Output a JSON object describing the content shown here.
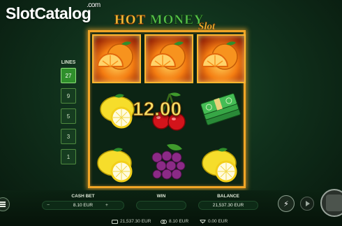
{
  "watermark": {
    "brand": "SlotCatalog",
    "suffix": ".com"
  },
  "logo": {
    "word_hot": "HOT",
    "word_money": "MONEY",
    "word_slot": "Slot"
  },
  "lines": {
    "title": "LINES",
    "options": [
      "27",
      "9",
      "5",
      "3",
      "1"
    ],
    "selected": "27"
  },
  "reels": [
    [
      "orange-fire",
      "lemon",
      "lemon"
    ],
    [
      "orange-fire",
      "cherries",
      "grapes"
    ],
    [
      "orange-fire",
      "cash-stack",
      "lemon"
    ]
  ],
  "win_display": "12.00",
  "bottom": {
    "cash_bet_label": "CASH BET",
    "cash_bet_value": "8.10 EUR",
    "minus": "−",
    "plus": "+",
    "win_label": "WIN",
    "win_value": "",
    "balance_label": "BALANCE",
    "balance_value": "21,537.30 EUR"
  },
  "status": {
    "balance": "21,537.30 EUR",
    "bet": "8.10 EUR",
    "win": "0.00 EUR"
  },
  "colors": {
    "frame": "#f0a526",
    "active_line": "#2f8f2c",
    "win_text": "#f8e26b"
  },
  "icons": {
    "menu": "hamburger-icon",
    "turbo": "lightning-icon",
    "autoplay": "play-icon",
    "spin": "spin-icon"
  }
}
